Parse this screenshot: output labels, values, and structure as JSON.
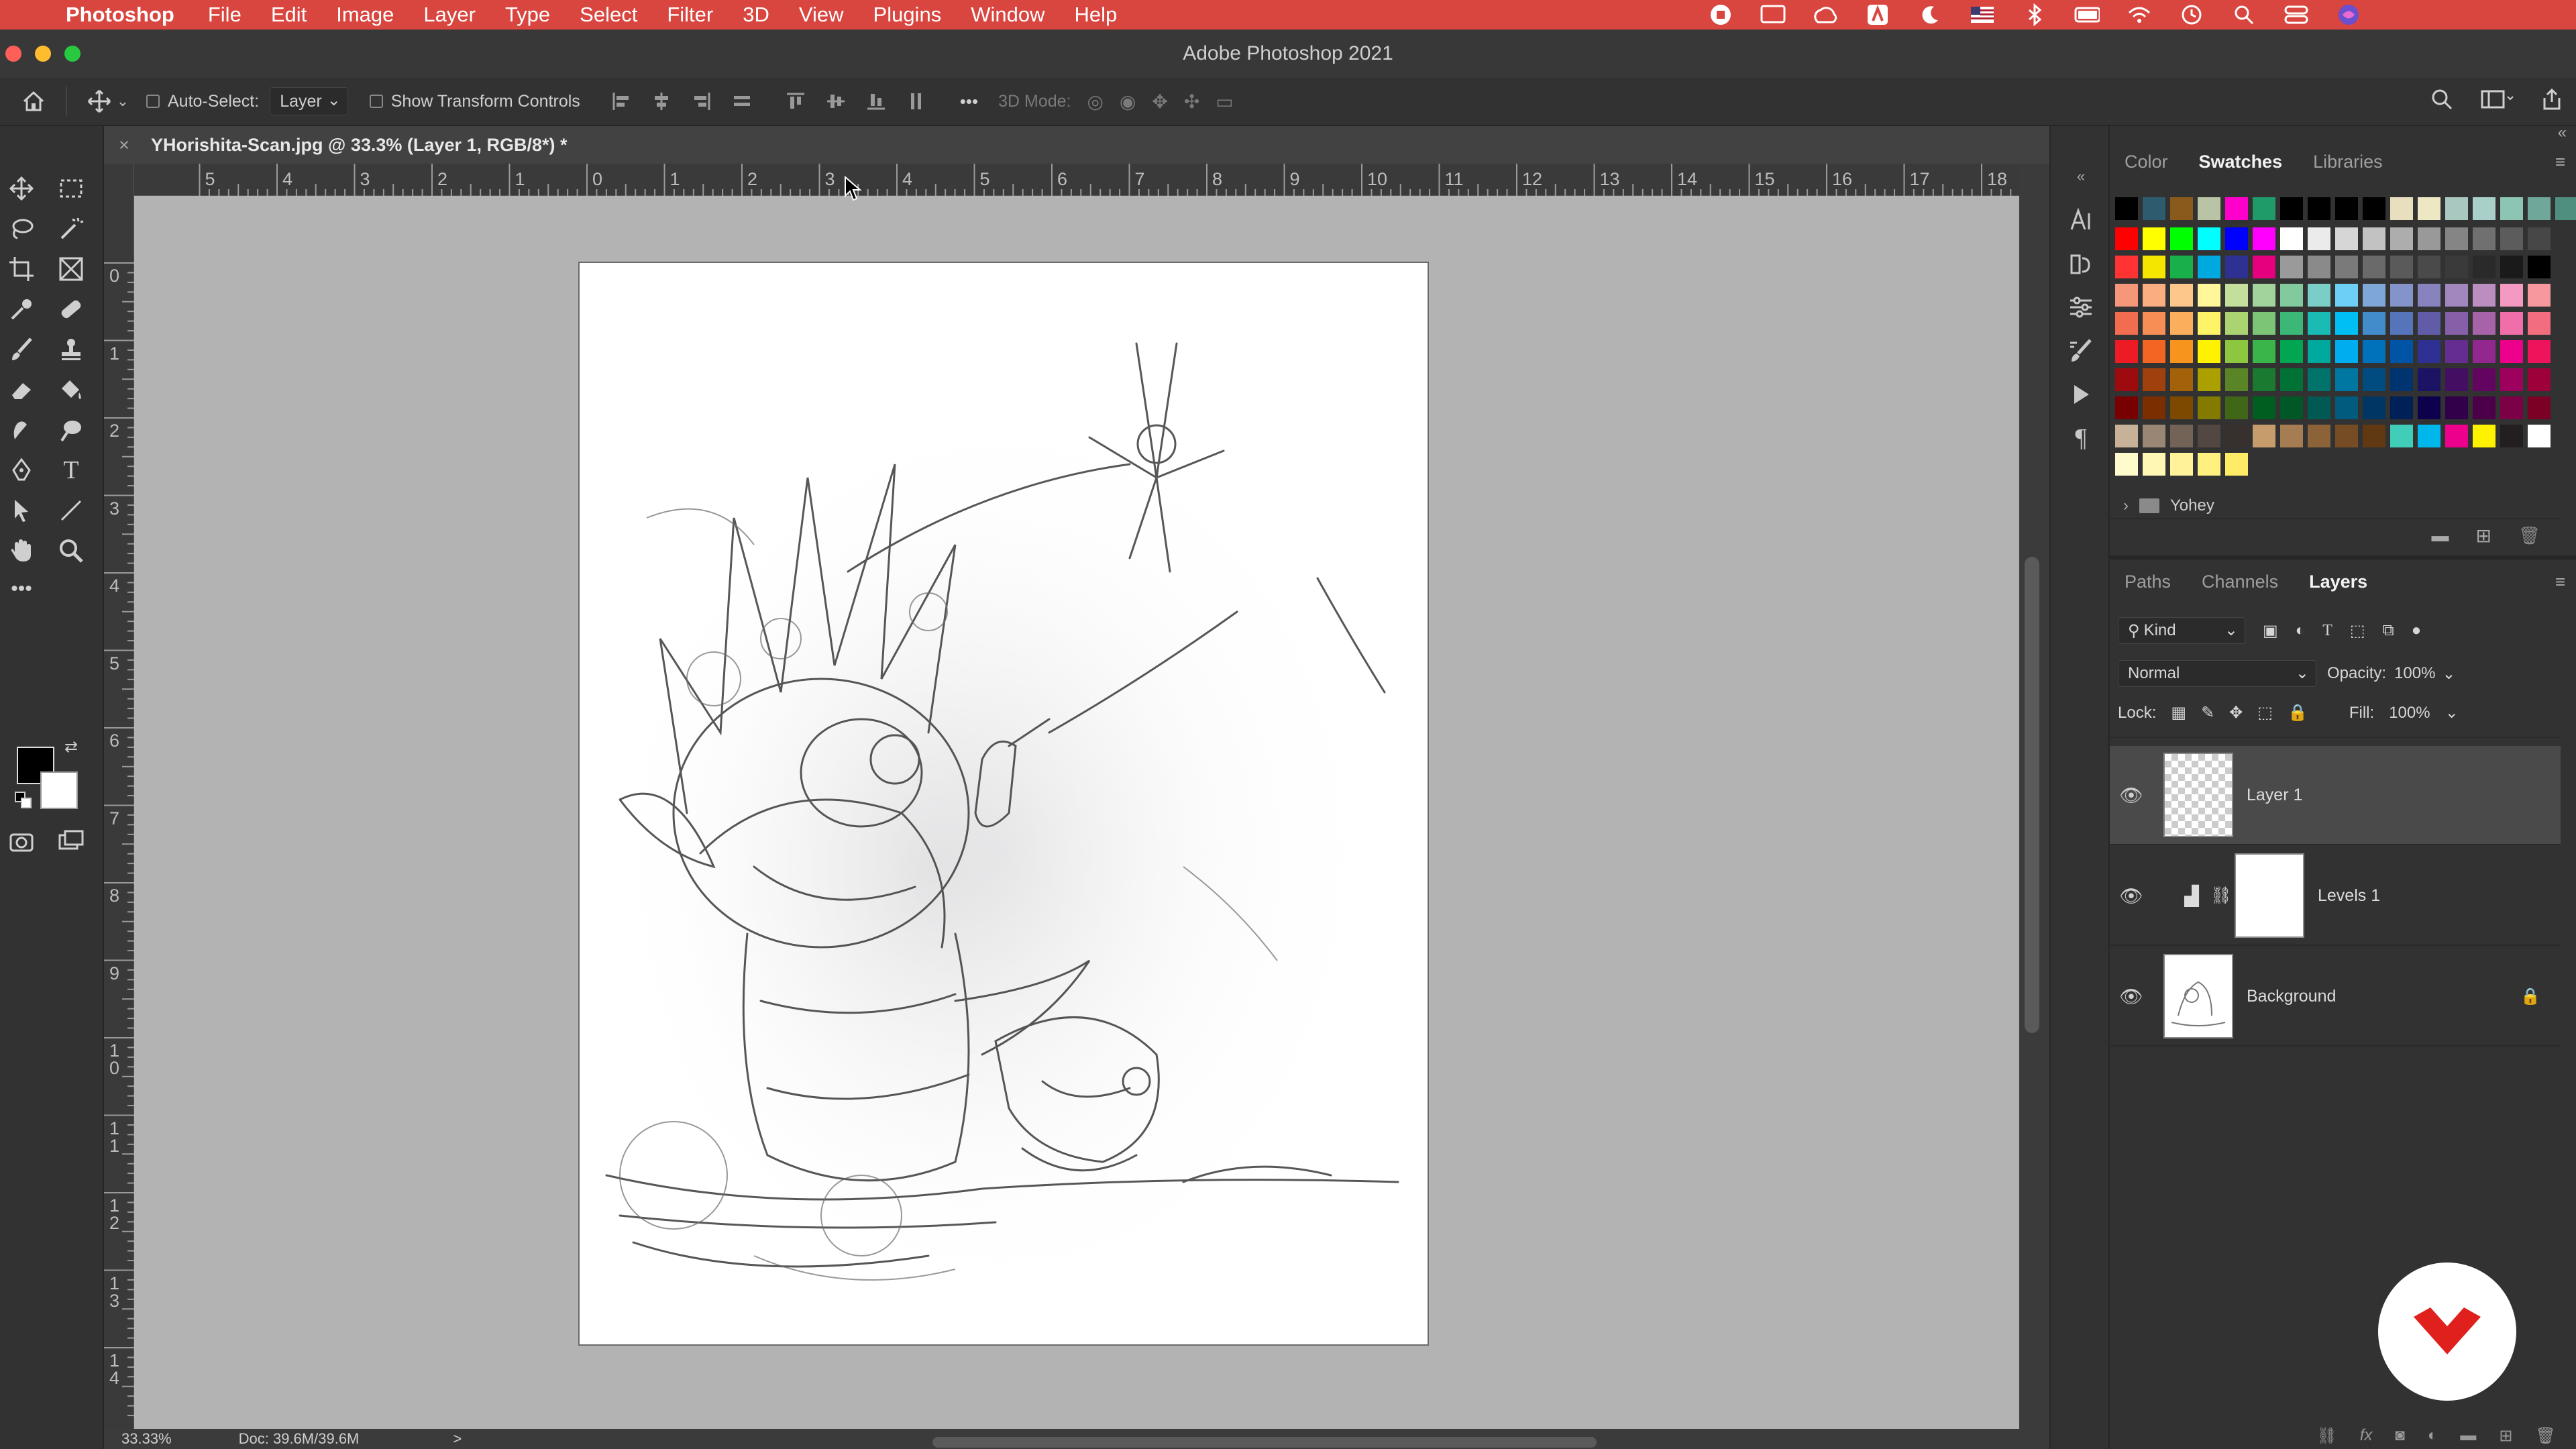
{
  "menubar": {
    "app_name": "Photoshop",
    "items": [
      "File",
      "Edit",
      "Image",
      "Layer",
      "Type",
      "Select",
      "Filter",
      "3D",
      "View",
      "Plugins",
      "Window",
      "Help"
    ]
  },
  "window": {
    "title": "Adobe Photoshop 2021"
  },
  "options_bar": {
    "auto_select_label": "Auto-Select:",
    "auto_select_value": "Layer",
    "show_transform_label": "Show Transform Controls",
    "mode_3d_label": "3D Mode:",
    "more_label": "•••"
  },
  "document": {
    "tab_title": "YHorishita-Scan.jpg @ 33.3% (Layer 1, RGB/8*) *",
    "close": "×"
  },
  "ruler": {
    "top_labels": [
      "5",
      "4",
      "3",
      "2",
      "1",
      "0",
      "1",
      "2",
      "3",
      "4",
      "5",
      "6",
      "7",
      "8",
      "9",
      "10",
      "11",
      "12",
      "13",
      "14",
      "15",
      "16",
      "17",
      "18"
    ],
    "left_labels": [
      "0",
      "1",
      "2",
      "3",
      "4",
      "5",
      "6",
      "7",
      "8",
      "9",
      "10",
      "11",
      "12",
      "13",
      "14"
    ]
  },
  "status": {
    "zoom": "33.33%",
    "doc": "Doc: 39.6M/39.6M",
    "arrow": ">"
  },
  "swatches_panel": {
    "tabs": [
      "Color",
      "Swatches",
      "Libraries"
    ],
    "active_tab": "Swatches",
    "group_name": "Yohey",
    "rows": [
      [
        "#000000",
        "#2e5b6e",
        "#8a5a1c",
        "#b9c4a6",
        "#ff00cc",
        "#1f9b6a",
        "#000000",
        "#000000",
        "#000000",
        "#000000",
        "#e8dfbf",
        "#eee7c4",
        "#a9c8c0",
        "#a8cfc9",
        "#8cc5b4",
        "#6fa89a",
        "#4f8f7f"
      ],
      [
        "#ff0000",
        "#ffff00",
        "#00ff00",
        "#00ffff",
        "#0000ff",
        "#ff00ff",
        "#ffffff",
        "#ebebeb",
        "#d6d6d6",
        "#c2c2c2",
        "#adadad",
        "#999999",
        "#858585",
        "#707070",
        "#5c5c5c",
        "#474747"
      ],
      [
        "#ff3333",
        "#f5e600",
        "#18b04a",
        "#00a8e0",
        "#2e3192",
        "#e6007e",
        "#9a9a9a",
        "#8a8a8a",
        "#7a7a7a",
        "#6a6a6a",
        "#5a5a5a",
        "#4a4a4a",
        "#3a3a3a",
        "#2a2a2a",
        "#1a1a1a",
        "#000000"
      ],
      [
        "#f7977a",
        "#f9ad81",
        "#fdc68a",
        "#fff79a",
        "#c4df9b",
        "#a2d39c",
        "#82ca9d",
        "#7bcdc8",
        "#6ecff6",
        "#7ea7d8",
        "#8493ca",
        "#8882be",
        "#a187be",
        "#bc8dbf",
        "#f49ac2",
        "#f6989d"
      ],
      [
        "#f26c4f",
        "#f68e55",
        "#fbaf5c",
        "#fff467",
        "#acd372",
        "#7cc576",
        "#3bb878",
        "#1abbb4",
        "#00bff3",
        "#438ccb",
        "#5574b9",
        "#605ca8",
        "#855fa8",
        "#a763a8",
        "#f06ea9",
        "#f26d7d"
      ],
      [
        "#ed1c24",
        "#f26522",
        "#f7941d",
        "#fff200",
        "#8dc63f",
        "#39b54a",
        "#00a651",
        "#00a99d",
        "#00aeef",
        "#0072bc",
        "#0054a6",
        "#2e3192",
        "#662d91",
        "#92278f",
        "#ec008c",
        "#ed145b"
      ],
      [
        "#9e0b0f",
        "#a0410d",
        "#a36209",
        "#aba000",
        "#598527",
        "#1a7b30",
        "#007236",
        "#00746b",
        "#0076a3",
        "#004b80",
        "#003471",
        "#1b1464",
        "#440e62",
        "#630460",
        "#9e005d",
        "#9e0039"
      ],
      [
        "#790000",
        "#7b2e00",
        "#7d4900",
        "#827b00",
        "#406618",
        "#005e20",
        "#005826",
        "#005952",
        "#005b7f",
        "#003663",
        "#002157",
        "#0d004c",
        "#32004b",
        "#4b0049",
        "#7b0046",
        "#7a0026"
      ],
      [
        "#c7b299",
        "#998675",
        "#736357",
        "#534741",
        "#37302d",
        "#c69c6d",
        "#a67c52",
        "#8c6239",
        "#754c24",
        "#603913",
        "#40ceb9",
        "#00b7eb",
        "#ec008c",
        "#fff200",
        "#231f20",
        "#ffffff"
      ],
      [
        "#fffbcc",
        "#fff7b3",
        "#fff299",
        "#fff080",
        "#ffeb66"
      ]
    ]
  },
  "layers_panel": {
    "tabs": [
      "Paths",
      "Channels",
      "Layers"
    ],
    "active_tab": "Layers",
    "filter_value": "Kind",
    "blend_mode": "Normal",
    "opacity_label": "Opacity:",
    "opacity_value": "100%",
    "lock_label": "Lock:",
    "fill_label": "Fill:",
    "fill_value": "100%",
    "layers": [
      {
        "name": "Layer 1",
        "selected": true
      },
      {
        "name": "Levels 1",
        "selected": false
      },
      {
        "name": "Background",
        "selected": false
      }
    ]
  },
  "colors": {
    "menubar": "#d9453f",
    "canvas": "#b3b3b3",
    "panel": "#323232",
    "badge": "#e0201c"
  }
}
